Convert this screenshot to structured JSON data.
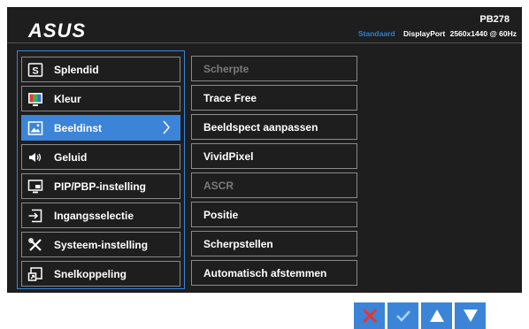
{
  "header": {
    "brand": "ASUS",
    "model": "PB278",
    "mode": "Standaard",
    "input": "DisplayPort",
    "resolution": "2560x1440 @ 60Hz"
  },
  "menu": {
    "items": [
      {
        "label": "Splendid",
        "icon": "splendid-icon"
      },
      {
        "label": "Kleur",
        "icon": "color-icon"
      },
      {
        "label": "Beeldinst",
        "icon": "image-icon",
        "selected": true
      },
      {
        "label": "Geluid",
        "icon": "speaker-icon"
      },
      {
        "label": "PIP/PBP-instelling",
        "icon": "pip-icon"
      },
      {
        "label": "Ingangsselectie",
        "icon": "input-select-icon"
      },
      {
        "label": "Systeem-instelling",
        "icon": "tools-icon"
      },
      {
        "label": "Snelkoppeling",
        "icon": "shortcut-icon"
      }
    ]
  },
  "submenu": {
    "items": [
      {
        "label": "Scherpte",
        "disabled": true
      },
      {
        "label": "Trace Free",
        "disabled": false
      },
      {
        "label": "Beeldspect aanpassen",
        "disabled": false
      },
      {
        "label": "VividPixel",
        "disabled": false
      },
      {
        "label": "ASCR",
        "disabled": true
      },
      {
        "label": "Positie",
        "disabled": false
      },
      {
        "label": "Scherpstellen",
        "disabled": false
      },
      {
        "label": "Automatisch afstemmen",
        "disabled": false
      }
    ]
  },
  "buttons": [
    {
      "name": "close",
      "icon": "close-icon",
      "color": "#e8352e"
    },
    {
      "name": "confirm",
      "icon": "checkmark-icon",
      "color": "#3b84d8"
    },
    {
      "name": "up",
      "icon": "arrow-up-icon",
      "color": "#ffffff"
    },
    {
      "name": "down",
      "icon": "arrow-down-icon",
      "color": "#ffffff"
    }
  ],
  "colors": {
    "accent": "#3b84d8",
    "background": "#1e1e1e",
    "status_mode": "#2f7fd0"
  }
}
